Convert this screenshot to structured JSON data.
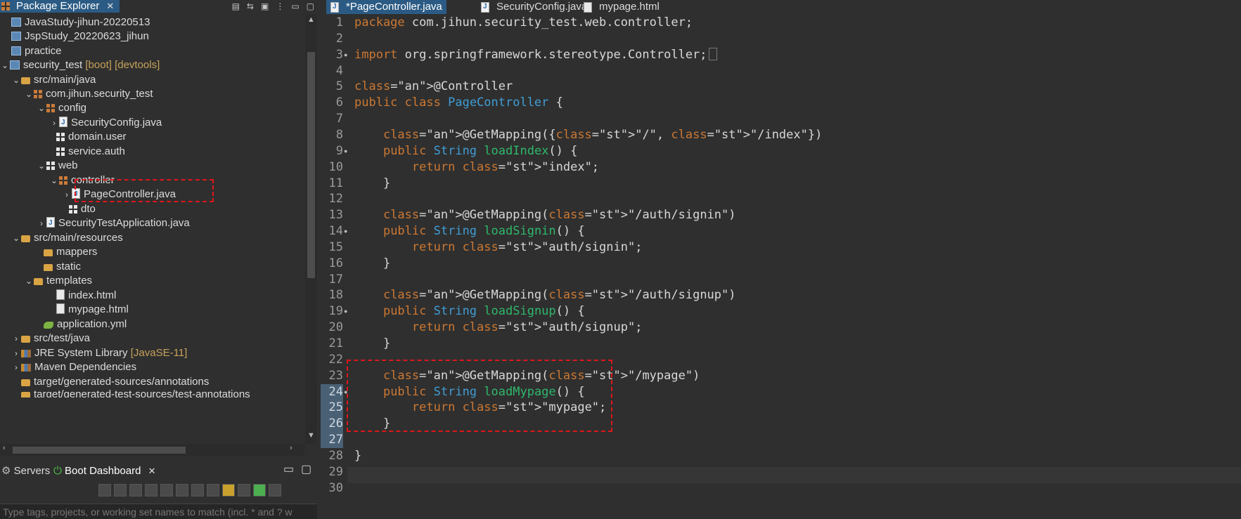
{
  "explorer": {
    "tab_label": "Package Explorer",
    "items": [
      {
        "label": "JavaStudy-jihun-20220513",
        "icon": "project-icon",
        "deco": ""
      },
      {
        "label": "JspStudy_20220623_jihun",
        "icon": "project-icon",
        "deco": ""
      },
      {
        "label": "practice",
        "icon": "project-icon",
        "deco": ""
      },
      {
        "label": "security_test",
        "icon": "boot-project-icon",
        "deco": "[boot] [devtools]"
      },
      {
        "label": "src/main/java",
        "icon": "source-folder-icon",
        "deco": ""
      },
      {
        "label": "com.jihun.security_test",
        "icon": "package-icon",
        "deco": ""
      },
      {
        "label": "config",
        "icon": "package-icon",
        "deco": ""
      },
      {
        "label": "SecurityConfig.java",
        "icon": "java-file-icon",
        "deco": ""
      },
      {
        "label": "domain.user",
        "icon": "package-icon",
        "deco": ""
      },
      {
        "label": "service.auth",
        "icon": "package-icon",
        "deco": ""
      },
      {
        "label": "web",
        "icon": "package-icon",
        "deco": ""
      },
      {
        "label": "controller",
        "icon": "package-icon",
        "deco": ""
      },
      {
        "label": "PageController.java",
        "icon": "java-file-icon",
        "deco": ""
      },
      {
        "label": "dto",
        "icon": "package-icon",
        "deco": ""
      },
      {
        "label": "SecurityTestApplication.java",
        "icon": "java-file-icon",
        "deco": ""
      },
      {
        "label": "src/main/resources",
        "icon": "source-folder-icon",
        "deco": ""
      },
      {
        "label": "mappers",
        "icon": "folder-icon",
        "deco": ""
      },
      {
        "label": "static",
        "icon": "folder-icon",
        "deco": ""
      },
      {
        "label": "templates",
        "icon": "folder-icon",
        "deco": ""
      },
      {
        "label": "index.html",
        "icon": "html-file-icon",
        "deco": ""
      },
      {
        "label": "mypage.html",
        "icon": "html-file-icon",
        "deco": ""
      },
      {
        "label": "application.yml",
        "icon": "yml-file-icon",
        "deco": ""
      },
      {
        "label": "src/test/java",
        "icon": "source-folder-icon",
        "deco": ""
      },
      {
        "label": "JRE System Library",
        "icon": "library-icon",
        "deco": "[JavaSE-11]"
      },
      {
        "label": "Maven Dependencies",
        "icon": "library-icon",
        "deco": ""
      },
      {
        "label": "target/generated-sources/annotations",
        "icon": "source-folder-icon",
        "deco": ""
      },
      {
        "label": "target/generated-test-sources/test-annotations",
        "icon": "source-folder-icon",
        "deco": ""
      }
    ]
  },
  "dashboard": {
    "tab_servers": "Servers",
    "tab_boot": "Boot Dashboard",
    "filter_placeholder": "Type tags, projects, or working set names to match (incl. * and ? w"
  },
  "editor": {
    "tabs": [
      "*PageController.java",
      "SecurityConfig.java",
      "mypage.html"
    ],
    "lines": [
      "package com.jihun.security_test.web.controller;",
      "",
      "import org.springframework.stereotype.Controller;",
      "",
      "@Controller",
      "public class PageController {",
      "",
      "    @GetMapping({\"/\", \"/index\"})",
      "    public String loadIndex() {",
      "        return \"index\";",
      "    }",
      "",
      "    @GetMapping(\"/auth/signin\")",
      "    public String loadSignin() {",
      "        return \"auth/signin\";",
      "    }",
      "",
      "    @GetMapping(\"/auth/signup\")",
      "    public String loadSignup() {",
      "        return \"auth/signup\";",
      "    }",
      "",
      "    @GetMapping(\"/mypage\")",
      "    public String loadMypage() {",
      "        return \"mypage\";",
      "    }",
      "",
      "}",
      "",
      ""
    ]
  },
  "colors": {
    "accent": "#2b5b84",
    "highlight_box": "#e0161b",
    "keyword": "#cc7832",
    "type": "#3f9dd6",
    "method": "#2fb86c",
    "string": "#3ec9c3"
  }
}
